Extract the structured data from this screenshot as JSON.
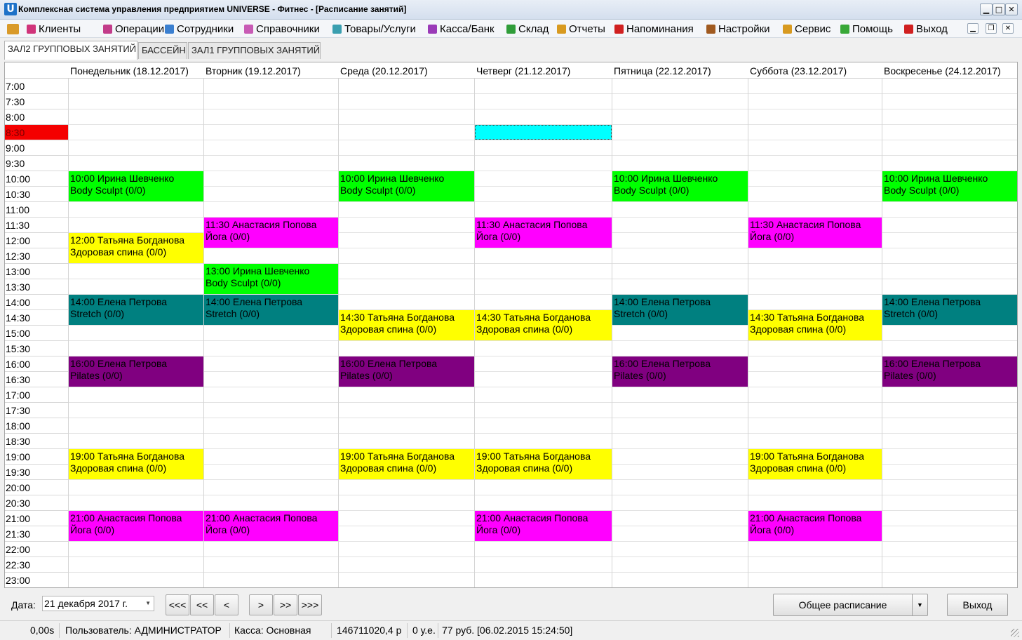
{
  "window": {
    "logo": "U",
    "title": "Комплексная система управления предприятием UNIVERSE - Фитнес - [Расписание занятий]",
    "controls": [
      "▁",
      "□",
      "✕"
    ]
  },
  "menu": [
    {
      "label": "Клиенты",
      "icon": "clients-icon",
      "color": "#d0347a"
    },
    {
      "label": "Операции",
      "icon": "operations-icon",
      "color": "#c23c8a"
    },
    {
      "label": "Сотрудники",
      "icon": "staff-icon",
      "color": "#3a7fd0"
    },
    {
      "label": "Справочники",
      "icon": "reference-icon",
      "color": "#c85bb5"
    },
    {
      "label": "Товары/Услуги",
      "icon": "goods-icon",
      "color": "#3a9fb0"
    },
    {
      "label": "Касса/Банк",
      "icon": "cash-icon",
      "color": "#9a3ab8"
    },
    {
      "label": "Склад",
      "icon": "warehouse-icon",
      "color": "#2f9d3a"
    },
    {
      "label": "Отчеты",
      "icon": "reports-icon",
      "color": "#d89a20"
    },
    {
      "label": "Напоминания",
      "icon": "reminder-icon",
      "color": "#d02020"
    },
    {
      "label": "Настройки",
      "icon": "settings-icon",
      "color": "#a05a20"
    },
    {
      "label": "Сервис",
      "icon": "service-icon",
      "color": "#d89a20"
    },
    {
      "label": "Помощь",
      "icon": "help-icon",
      "color": "#38a838"
    },
    {
      "label": "Выход",
      "icon": "exit-icon",
      "color": "#d02020"
    }
  ],
  "mdi_controls": [
    "▁",
    "❐",
    "✕"
  ],
  "tabs": [
    {
      "label": "ЗАЛ2 ГРУППОВЫХ ЗАНЯТИЙ",
      "active": true
    },
    {
      "label": "БАССЕЙН",
      "active": false
    },
    {
      "label": "ЗАЛ1 ГРУППОВЫХ ЗАНЯТИЙ",
      "active": false
    }
  ],
  "days": [
    "Понедельник (18.12.2017)",
    "Вторник (19.12.2017)",
    "Среда (20.12.2017)",
    "Четверг (21.12.2017)",
    "Пятница (22.12.2017)",
    "Суббота (23.12.2017)",
    "Воскресенье (24.12.2017)"
  ],
  "times": [
    "7:00",
    "7:30",
    "8:00",
    "8:30",
    "9:00",
    "9:30",
    "10:00",
    "10:30",
    "11:00",
    "11:30",
    "12:00",
    "12:30",
    "13:00",
    "13:30",
    "14:00",
    "14:30",
    "15:00",
    "15:30",
    "16:00",
    "16:30",
    "17:00",
    "17:30",
    "18:00",
    "18:30",
    "19:00",
    "19:30",
    "20:00",
    "20:30",
    "21:00",
    "21:30",
    "22:00",
    "22:30",
    "23:00"
  ],
  "current_time_slot": "8:30",
  "selected_cell": {
    "day": 3,
    "time": "8:30"
  },
  "lessons": [
    {
      "day": 0,
      "start": "10:00",
      "slots": 2,
      "line1": "10:00 Ирина Шевченко",
      "line2": "Body Sculpt (0/0)",
      "color": "#00ff00"
    },
    {
      "day": 2,
      "start": "10:00",
      "slots": 2,
      "line1": "10:00 Ирина Шевченко",
      "line2": "Body Sculpt (0/0)",
      "color": "#00ff00"
    },
    {
      "day": 4,
      "start": "10:00",
      "slots": 2,
      "line1": "10:00 Ирина Шевченко",
      "line2": "Body Sculpt (0/0)",
      "color": "#00ff00"
    },
    {
      "day": 6,
      "start": "10:00",
      "slots": 2,
      "line1": "10:00 Ирина Шевченко",
      "line2": "Body Sculpt (0/0)",
      "color": "#00ff00"
    },
    {
      "day": 1,
      "start": "11:30",
      "slots": 2,
      "line1": "11:30 Анастасия Попова",
      "line2": "Йога (0/0)",
      "color": "#ff00ff"
    },
    {
      "day": 3,
      "start": "11:30",
      "slots": 2,
      "line1": "11:30 Анастасия Попова",
      "line2": "Йога (0/0)",
      "color": "#ff00ff"
    },
    {
      "day": 5,
      "start": "11:30",
      "slots": 2,
      "line1": "11:30 Анастасия Попова",
      "line2": "Йога (0/0)",
      "color": "#ff00ff"
    },
    {
      "day": 0,
      "start": "12:00",
      "slots": 2,
      "line1": "12:00 Татьяна Богданова",
      "line2": "Здоровая спина (0/0)",
      "color": "#ffff00"
    },
    {
      "day": 1,
      "start": "13:00",
      "slots": 2,
      "line1": "13:00 Ирина Шевченко",
      "line2": "Body Sculpt (0/0)",
      "color": "#00ff00"
    },
    {
      "day": 0,
      "start": "14:00",
      "slots": 2,
      "line1": "14:00 Елена Петрова",
      "line2": "Stretch (0/0)",
      "color": "#008080"
    },
    {
      "day": 1,
      "start": "14:00",
      "slots": 2,
      "line1": "14:00 Елена Петрова",
      "line2": "Stretch (0/0)",
      "color": "#008080"
    },
    {
      "day": 4,
      "start": "14:00",
      "slots": 2,
      "line1": "14:00 Елена Петрова",
      "line2": "Stretch (0/0)",
      "color": "#008080"
    },
    {
      "day": 6,
      "start": "14:00",
      "slots": 2,
      "line1": "14:00 Елена Петрова",
      "line2": "Stretch (0/0)",
      "color": "#008080"
    },
    {
      "day": 2,
      "start": "14:30",
      "slots": 2,
      "line1": "14:30 Татьяна Богданова",
      "line2": "Здоровая спина (0/0)",
      "color": "#ffff00"
    },
    {
      "day": 3,
      "start": "14:30",
      "slots": 2,
      "line1": "14:30 Татьяна Богданова",
      "line2": "Здоровая спина (0/0)",
      "color": "#ffff00"
    },
    {
      "day": 5,
      "start": "14:30",
      "slots": 2,
      "line1": "14:30 Татьяна Богданова",
      "line2": "Здоровая спина (0/0)",
      "color": "#ffff00"
    },
    {
      "day": 0,
      "start": "16:00",
      "slots": 2,
      "line1": "16:00 Елена Петрова",
      "line2": "Pilates (0/0)",
      "color": "#800080"
    },
    {
      "day": 2,
      "start": "16:00",
      "slots": 2,
      "line1": "16:00 Елена Петрова",
      "line2": "Pilates (0/0)",
      "color": "#800080"
    },
    {
      "day": 4,
      "start": "16:00",
      "slots": 2,
      "line1": "16:00 Елена Петрова",
      "line2": "Pilates (0/0)",
      "color": "#800080"
    },
    {
      "day": 6,
      "start": "16:00",
      "slots": 2,
      "line1": "16:00 Елена Петрова",
      "line2": "Pilates (0/0)",
      "color": "#800080"
    },
    {
      "day": 0,
      "start": "19:00",
      "slots": 2,
      "line1": "19:00 Татьяна Богданова",
      "line2": "Здоровая спина (0/0)",
      "color": "#ffff00"
    },
    {
      "day": 2,
      "start": "19:00",
      "slots": 2,
      "line1": "19:00 Татьяна Богданова",
      "line2": "Здоровая спина (0/0)",
      "color": "#ffff00"
    },
    {
      "day": 3,
      "start": "19:00",
      "slots": 2,
      "line1": "19:00 Татьяна Богданова",
      "line2": "Здоровая спина (0/0)",
      "color": "#ffff00"
    },
    {
      "day": 5,
      "start": "19:00",
      "slots": 2,
      "line1": "19:00 Татьяна Богданова",
      "line2": "Здоровая спина (0/0)",
      "color": "#ffff00"
    },
    {
      "day": 0,
      "start": "21:00",
      "slots": 2,
      "line1": "21:00 Анастасия Попова",
      "line2": "Йога (0/0)",
      "color": "#ff00ff"
    },
    {
      "day": 1,
      "start": "21:00",
      "slots": 2,
      "line1": "21:00 Анастасия Попова",
      "line2": "Йога (0/0)",
      "color": "#ff00ff"
    },
    {
      "day": 3,
      "start": "21:00",
      "slots": 2,
      "line1": "21:00 Анастасия Попова",
      "line2": "Йога (0/0)",
      "color": "#ff00ff"
    },
    {
      "day": 5,
      "start": "21:00",
      "slots": 2,
      "line1": "21:00 Анастасия Попова",
      "line2": "Йога (0/0)",
      "color": "#ff00ff"
    }
  ],
  "bottom": {
    "date_label": "Дата:",
    "date_value": "21 декабря 2017 г.",
    "nav": [
      "<<<",
      "<<",
      "<",
      ">",
      ">>",
      ">>>"
    ],
    "schedule_button": "Общее расписание",
    "exit_button": "Выход"
  },
  "status": {
    "time": "0,00s",
    "user": "Пользователь: АДМИНИСТРАТОР",
    "cash": "Касса: Основная",
    "balance": "146711020,4 р",
    "ue": "0 у.е.",
    "rate": "77 руб. [06.02.2015 15:24:50]"
  }
}
